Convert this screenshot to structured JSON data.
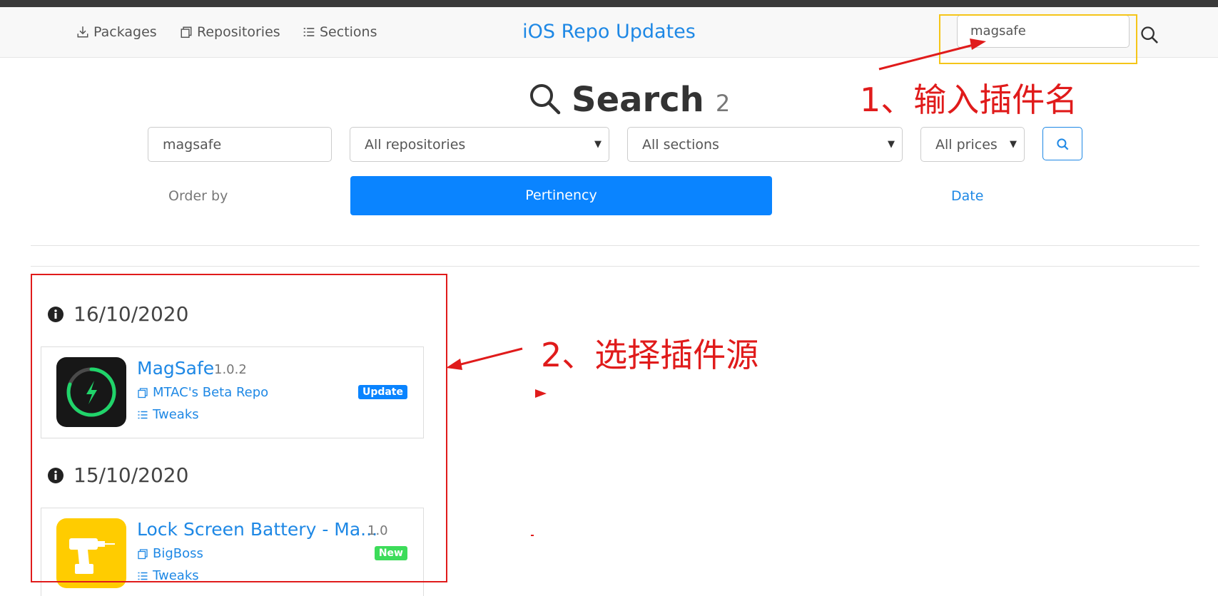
{
  "navbar": {
    "links": [
      {
        "label": "Packages",
        "icon": "download-icon"
      },
      {
        "label": "Repositories",
        "icon": "copy-icon"
      },
      {
        "label": "Sections",
        "icon": "list-icon"
      }
    ],
    "brand": "iOS Repo Updates",
    "search_value": "magsafe"
  },
  "search": {
    "title": "Search",
    "count": "2",
    "query_value": "magsafe",
    "repository_select": "All repositories",
    "section_select": "All sections",
    "price_select": "All prices"
  },
  "order": {
    "label": "Order by",
    "options": [
      "Pertinency",
      "Date"
    ],
    "active": "Pertinency"
  },
  "results": [
    {
      "date": "16/10/2020",
      "name": "MagSafe",
      "version": "1.0.2",
      "repo": "MTAC's Beta Repo",
      "section": "Tweaks",
      "badge": "Update",
      "badge_color": "#0a84ff"
    },
    {
      "date": "15/10/2020",
      "name": "Lock Screen Battery - Ma...",
      "version": "1.0",
      "repo": "BigBoss",
      "section": "Tweaks",
      "badge": "New",
      "badge_color": "#3ddc5a"
    }
  ],
  "annotations": {
    "step1": "1、输入插件名",
    "step2": "2、选择插件源",
    "color": "#e01b1b",
    "highlight_color": "#f5c518"
  },
  "colors": {
    "accent": "#1e88e5",
    "primary_button": "#0a84ff"
  }
}
